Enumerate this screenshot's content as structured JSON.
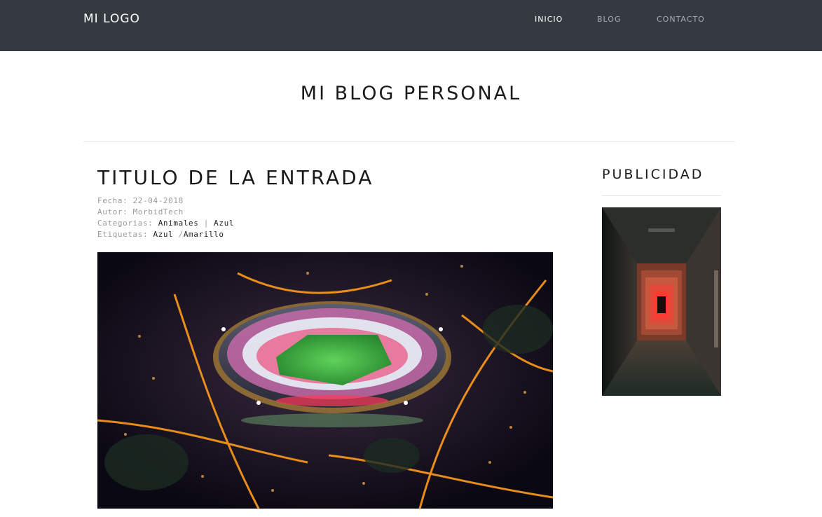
{
  "header": {
    "logo": "MI LOGO",
    "nav": [
      {
        "label": "INICIO",
        "active": true
      },
      {
        "label": "BLOG",
        "active": false
      },
      {
        "label": "CONTACTO",
        "active": false
      }
    ]
  },
  "site": {
    "title": "MI BLOG PERSONAL"
  },
  "post": {
    "title": "TITULO DE LA ENTRADA",
    "date_label": "Fecha:",
    "date": "22-04-2018",
    "author_label": "Autor:",
    "author": "MorbidTech",
    "categories_label": "Categorias:",
    "categories": [
      "Animales",
      "Azul"
    ],
    "categories_sep": "|",
    "tags_label": "Etiquetas:",
    "tags": [
      "Azul",
      "Amarillo"
    ],
    "tags_sep": "/"
  },
  "sidebar": {
    "title": "PUBLICIDAD"
  },
  "colors": {
    "topbar": "#343a40",
    "nav_active": "#ffffff",
    "nav_inactive": "#a8adb3",
    "meta_text": "#9a9a9a"
  }
}
